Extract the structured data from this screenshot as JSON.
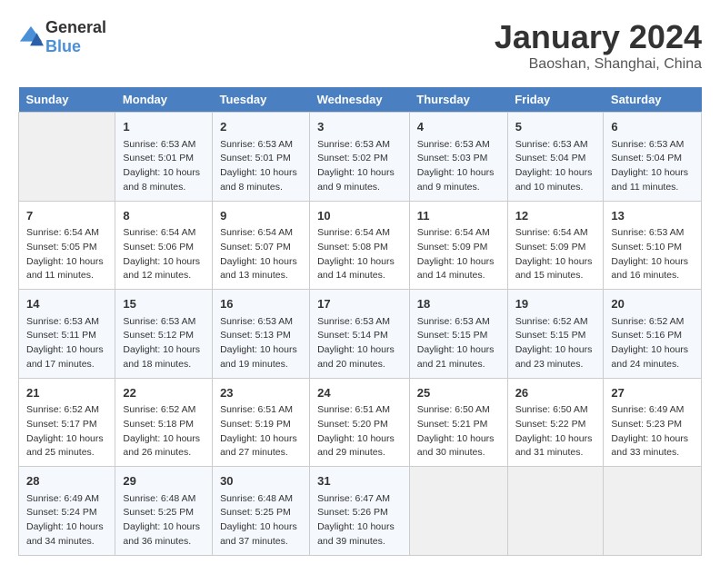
{
  "header": {
    "logo_general": "General",
    "logo_blue": "Blue",
    "title": "January 2024",
    "subtitle": "Baoshan, Shanghai, China"
  },
  "columns": [
    "Sunday",
    "Monday",
    "Tuesday",
    "Wednesday",
    "Thursday",
    "Friday",
    "Saturday"
  ],
  "weeks": [
    [
      {
        "day": "",
        "empty": true
      },
      {
        "day": "1",
        "sunrise": "6:53 AM",
        "sunset": "5:01 PM",
        "daylight": "10 hours and 8 minutes."
      },
      {
        "day": "2",
        "sunrise": "6:53 AM",
        "sunset": "5:01 PM",
        "daylight": "10 hours and 8 minutes."
      },
      {
        "day": "3",
        "sunrise": "6:53 AM",
        "sunset": "5:02 PM",
        "daylight": "10 hours and 9 minutes."
      },
      {
        "day": "4",
        "sunrise": "6:53 AM",
        "sunset": "5:03 PM",
        "daylight": "10 hours and 9 minutes."
      },
      {
        "day": "5",
        "sunrise": "6:53 AM",
        "sunset": "5:04 PM",
        "daylight": "10 hours and 10 minutes."
      },
      {
        "day": "6",
        "sunrise": "6:53 AM",
        "sunset": "5:04 PM",
        "daylight": "10 hours and 11 minutes."
      }
    ],
    [
      {
        "day": "7",
        "sunrise": "6:54 AM",
        "sunset": "5:05 PM",
        "daylight": "10 hours and 11 minutes."
      },
      {
        "day": "8",
        "sunrise": "6:54 AM",
        "sunset": "5:06 PM",
        "daylight": "10 hours and 12 minutes."
      },
      {
        "day": "9",
        "sunrise": "6:54 AM",
        "sunset": "5:07 PM",
        "daylight": "10 hours and 13 minutes."
      },
      {
        "day": "10",
        "sunrise": "6:54 AM",
        "sunset": "5:08 PM",
        "daylight": "10 hours and 14 minutes."
      },
      {
        "day": "11",
        "sunrise": "6:54 AM",
        "sunset": "5:09 PM",
        "daylight": "10 hours and 14 minutes."
      },
      {
        "day": "12",
        "sunrise": "6:54 AM",
        "sunset": "5:09 PM",
        "daylight": "10 hours and 15 minutes."
      },
      {
        "day": "13",
        "sunrise": "6:53 AM",
        "sunset": "5:10 PM",
        "daylight": "10 hours and 16 minutes."
      }
    ],
    [
      {
        "day": "14",
        "sunrise": "6:53 AM",
        "sunset": "5:11 PM",
        "daylight": "10 hours and 17 minutes."
      },
      {
        "day": "15",
        "sunrise": "6:53 AM",
        "sunset": "5:12 PM",
        "daylight": "10 hours and 18 minutes."
      },
      {
        "day": "16",
        "sunrise": "6:53 AM",
        "sunset": "5:13 PM",
        "daylight": "10 hours and 19 minutes."
      },
      {
        "day": "17",
        "sunrise": "6:53 AM",
        "sunset": "5:14 PM",
        "daylight": "10 hours and 20 minutes."
      },
      {
        "day": "18",
        "sunrise": "6:53 AM",
        "sunset": "5:15 PM",
        "daylight": "10 hours and 21 minutes."
      },
      {
        "day": "19",
        "sunrise": "6:52 AM",
        "sunset": "5:15 PM",
        "daylight": "10 hours and 23 minutes."
      },
      {
        "day": "20",
        "sunrise": "6:52 AM",
        "sunset": "5:16 PM",
        "daylight": "10 hours and 24 minutes."
      }
    ],
    [
      {
        "day": "21",
        "sunrise": "6:52 AM",
        "sunset": "5:17 PM",
        "daylight": "10 hours and 25 minutes."
      },
      {
        "day": "22",
        "sunrise": "6:52 AM",
        "sunset": "5:18 PM",
        "daylight": "10 hours and 26 minutes."
      },
      {
        "day": "23",
        "sunrise": "6:51 AM",
        "sunset": "5:19 PM",
        "daylight": "10 hours and 27 minutes."
      },
      {
        "day": "24",
        "sunrise": "6:51 AM",
        "sunset": "5:20 PM",
        "daylight": "10 hours and 29 minutes."
      },
      {
        "day": "25",
        "sunrise": "6:50 AM",
        "sunset": "5:21 PM",
        "daylight": "10 hours and 30 minutes."
      },
      {
        "day": "26",
        "sunrise": "6:50 AM",
        "sunset": "5:22 PM",
        "daylight": "10 hours and 31 minutes."
      },
      {
        "day": "27",
        "sunrise": "6:49 AM",
        "sunset": "5:23 PM",
        "daylight": "10 hours and 33 minutes."
      }
    ],
    [
      {
        "day": "28",
        "sunrise": "6:49 AM",
        "sunset": "5:24 PM",
        "daylight": "10 hours and 34 minutes."
      },
      {
        "day": "29",
        "sunrise": "6:48 AM",
        "sunset": "5:25 PM",
        "daylight": "10 hours and 36 minutes."
      },
      {
        "day": "30",
        "sunrise": "6:48 AM",
        "sunset": "5:25 PM",
        "daylight": "10 hours and 37 minutes."
      },
      {
        "day": "31",
        "sunrise": "6:47 AM",
        "sunset": "5:26 PM",
        "daylight": "10 hours and 39 minutes."
      },
      {
        "day": "",
        "empty": true
      },
      {
        "day": "",
        "empty": true
      },
      {
        "day": "",
        "empty": true
      }
    ]
  ],
  "labels": {
    "sunrise_prefix": "Sunrise: ",
    "sunset_prefix": "Sunset: ",
    "daylight_prefix": "Daylight: "
  }
}
